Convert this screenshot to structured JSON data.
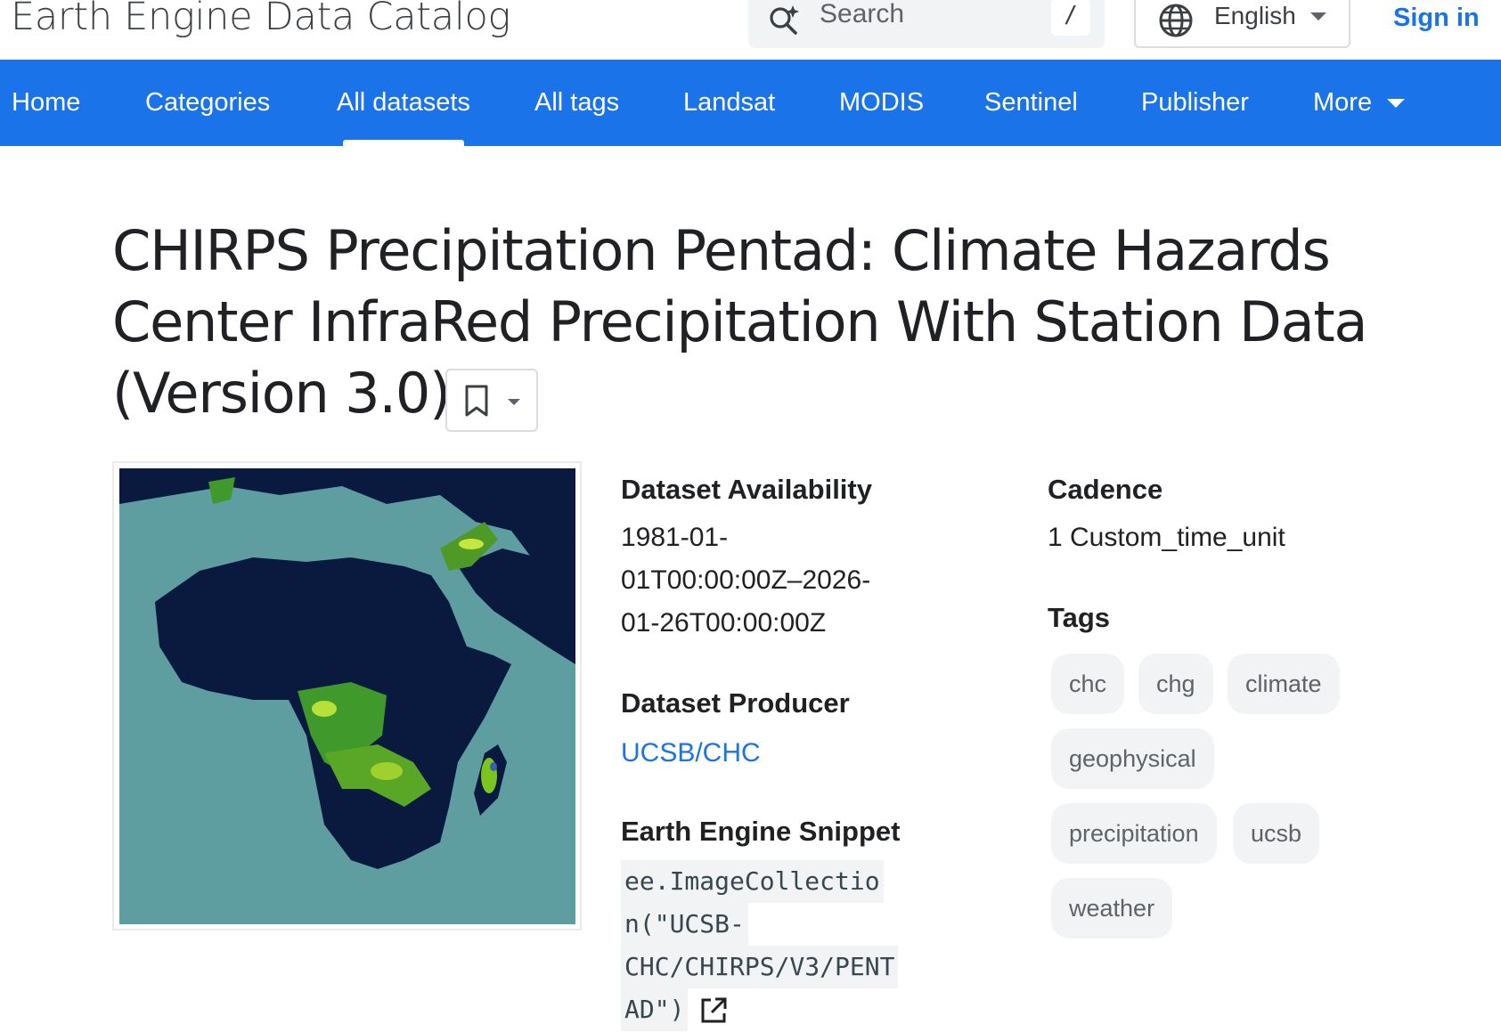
{
  "header": {
    "site_title": "Earth Engine Data Catalog",
    "search_placeholder": "Search",
    "search_shortcut": "/",
    "language": "English",
    "sign_in": "Sign in"
  },
  "nav": {
    "items": [
      "Home",
      "Categories",
      "All datasets",
      "All tags",
      "Landsat",
      "MODIS",
      "Sentinel",
      "Publisher",
      "More"
    ],
    "active": "All datasets"
  },
  "dataset": {
    "title": "CHIRPS Precipitation Pentad: Climate Hazards Center InfraRed Precipitation With Station Data (Version 3.0)",
    "availability_label": "Dataset Availability",
    "availability_lines": [
      "1981-01-",
      "01T00:00:00Z–2026-",
      "01-26T00:00:00Z"
    ],
    "producer_label": "Dataset Producer",
    "producer": "UCSB/CHC",
    "snippet_label": "Earth Engine Snippet",
    "snippet_lines": [
      "ee.ImageCollectio",
      "n(\"UCSB-",
      "CHC/CHIRPS/V3/PENT",
      "AD\")"
    ],
    "cadence_label": "Cadence",
    "cadence": "1 Custom_time_unit",
    "tags_label": "Tags",
    "tags": [
      "chc",
      "chg",
      "climate",
      "geophysical",
      "precipitation",
      "ucsb",
      "weather"
    ]
  },
  "colors": {
    "brand_blue": "#1a73e8",
    "map_ocean": "#5f9ea0",
    "map_land": "#0a1a3f",
    "map_rain": "#7cc520"
  }
}
